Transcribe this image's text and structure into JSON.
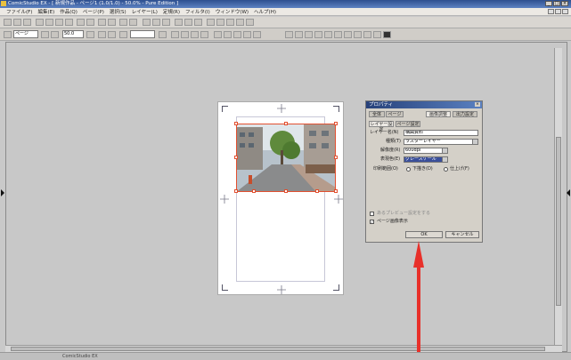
{
  "window": {
    "title": "ComicStudio EX - [ 新規作品 - ページ1 (1.0/1.0) - 50.0% - Pure Edition ]"
  },
  "menu": [
    "ファイル(F)",
    "編集(E)",
    "作品(Q)",
    "ページ(P)",
    "選択(S)",
    "レイヤー(L)",
    "定規(R)",
    "フィルタ(I)",
    "ウィンドウ(W)",
    "ヘルプ(H)"
  ],
  "toolbar": {
    "page_label": "ページ",
    "zoom_value": "50.0"
  },
  "status": {
    "text": "ComicStudio EX"
  },
  "properties_panel": {
    "title": "プロパティ",
    "tabs": [
      "全体",
      "ページ",
      "画像調整",
      "出力設定"
    ],
    "sub_tabs": [
      "レイヤー設定",
      "ページ設定"
    ],
    "layer_name_label": "レイヤー名(N)",
    "layer_name_value": "構図資料",
    "type_label": "種類(T)",
    "type_value": "ラスターレイヤー",
    "resolution_label": "解像度(R)",
    "resolution_value": "600dpi",
    "expression_label": "表現色(E)",
    "expression_value": "グレースケール",
    "output_label": "印刷範囲(O)",
    "output_options": [
      "下描き(D)",
      "仕上げ(F)"
    ],
    "checkboxes": [
      "あるプレビュー設定をする",
      "ページ画像表示"
    ],
    "ok_label": "OK",
    "cancel_label": "キャンセル"
  },
  "colors": {
    "selection": "#e25030",
    "arrow": "#e8302a",
    "panel_title": "#27417a"
  }
}
